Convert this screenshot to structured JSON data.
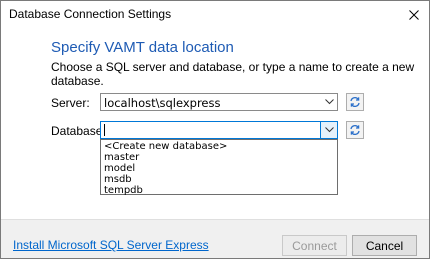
{
  "window": {
    "title": "Database Connection Settings"
  },
  "content": {
    "heading": "Specify VAMT data location",
    "subtitle": "Choose a SQL server and database, or type a name to create a new database."
  },
  "server": {
    "label": "Server:",
    "value": "localhost\\sqlexpress"
  },
  "database": {
    "label": "Database:",
    "value": "",
    "options": [
      "<Create new database>",
      "master",
      "model",
      "msdb",
      "tempdb"
    ]
  },
  "footer": {
    "link_text": "Install Microsoft SQL Server Express",
    "connect_label": "Connect",
    "cancel_label": "Cancel"
  },
  "colors": {
    "accent": "#1e5bb4",
    "link": "#0066cc",
    "focus_border": "#0078d7",
    "footer_bg": "#f0f0f0"
  },
  "icons": {
    "close": "close-icon",
    "dropdown": "chevron-down-icon",
    "refresh": "refresh-icon"
  }
}
